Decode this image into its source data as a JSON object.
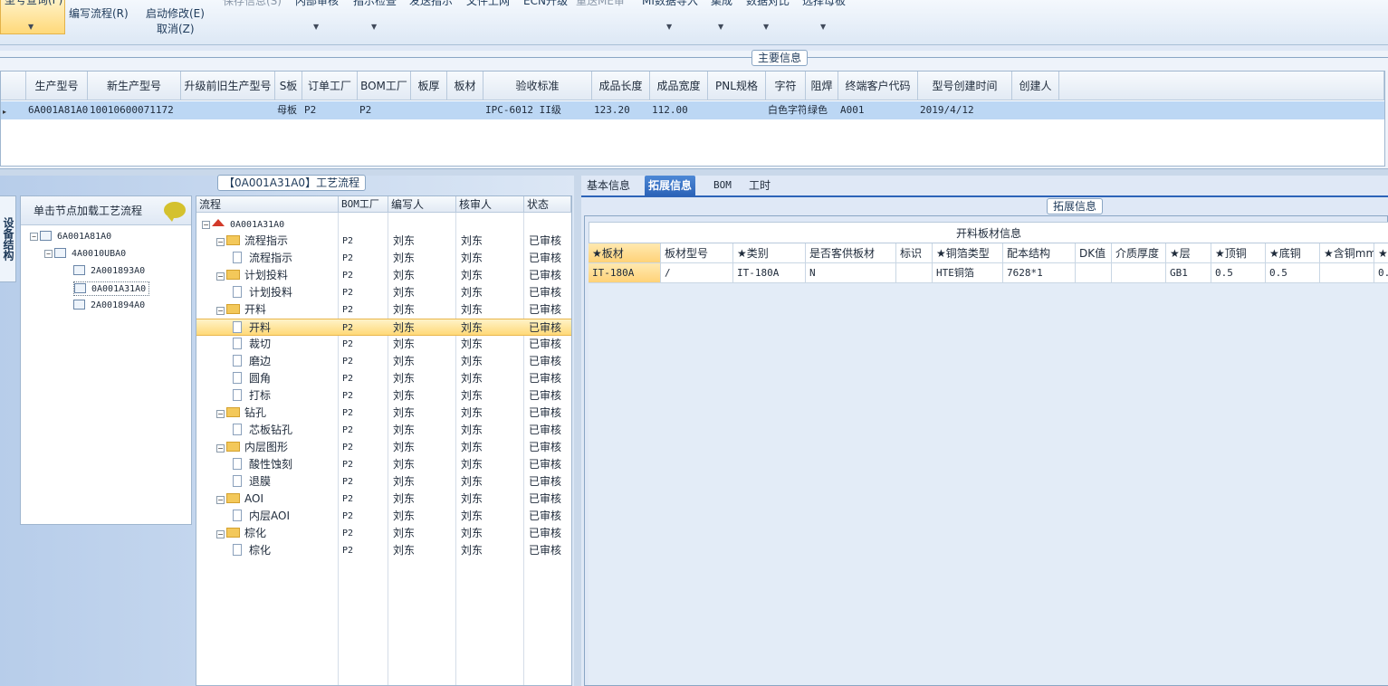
{
  "toolbar": {
    "query_label": "型号查询(F)",
    "write_label": "编写流程(R)",
    "start_edit_label": "启动修改(E)",
    "cancel_label": "取消(Z)",
    "save_label": "保存信息(S)",
    "inner_review_label": "内部审核",
    "instruction_check_label": "指示检查",
    "send_instruction_label": "发送指示",
    "doc_upload_label": "文件上网",
    "ecn_label": "ECN升级",
    "rework_label": "重送ME审",
    "mi_import_label": "MI数据导入",
    "set_label": "集成",
    "data_compare_label": "数据对比",
    "select_template_label": "选择母板"
  },
  "main_info": {
    "title": "主要信息",
    "columns": [
      "生产型号",
      "新生产型号",
      "升级前旧生产型号",
      "S板",
      "订单工厂",
      "BOM工厂",
      "板厚",
      "板材",
      "验收标准",
      "成品长度",
      "成品宽度",
      "PNL规格",
      "字符",
      "阻焊",
      "终端客户代码",
      "型号创建时间",
      "创建人"
    ],
    "row": [
      "6A001A81A0",
      "10010600071172",
      "",
      "母板",
      "P2",
      "P2",
      "",
      "",
      "IPC-6012 II级",
      "123.20",
      "112.00",
      "",
      "白色字符",
      "绿色",
      "A001",
      "2019/4/12",
      ""
    ]
  },
  "left": {
    "vertical_tab": "设备结构",
    "structure_header": "单击节点加载工艺流程",
    "structure_nodes": [
      "6A001A81A0",
      "4A0010UBA0",
      "2A001893A0",
      "0A001A31A0",
      "2A001894A0"
    ],
    "process_title": "【0A001A31A0】工艺流程",
    "process_columns": [
      "流程",
      "BOM工厂",
      "编写人",
      "核审人",
      "状态"
    ],
    "process_root": "0A001A31A0",
    "process_rows": [
      {
        "name": "流程指示",
        "type": "folder",
        "bom": "P2",
        "writer": "刘东",
        "reviewer": "刘东",
        "status": "已审核"
      },
      {
        "name": "流程指示",
        "type": "file",
        "bom": "P2",
        "writer": "刘东",
        "reviewer": "刘东",
        "status": "已审核"
      },
      {
        "name": "计划投料",
        "type": "folder",
        "bom": "P2",
        "writer": "刘东",
        "reviewer": "刘东",
        "status": "已审核"
      },
      {
        "name": "计划投料",
        "type": "file",
        "bom": "P2",
        "writer": "刘东",
        "reviewer": "刘东",
        "status": "已审核"
      },
      {
        "name": "开料",
        "type": "folder",
        "bom": "P2",
        "writer": "刘东",
        "reviewer": "刘东",
        "status": "已审核"
      },
      {
        "name": "开料",
        "type": "file",
        "bom": "P2",
        "writer": "刘东",
        "reviewer": "刘东",
        "status": "已审核",
        "selected": true
      },
      {
        "name": "裁切",
        "type": "file",
        "bom": "P2",
        "writer": "刘东",
        "reviewer": "刘东",
        "status": "已审核"
      },
      {
        "name": "磨边",
        "type": "file",
        "bom": "P2",
        "writer": "刘东",
        "reviewer": "刘东",
        "status": "已审核"
      },
      {
        "name": "圆角",
        "type": "file",
        "bom": "P2",
        "writer": "刘东",
        "reviewer": "刘东",
        "status": "已审核"
      },
      {
        "name": "打标",
        "type": "file",
        "bom": "P2",
        "writer": "刘东",
        "reviewer": "刘东",
        "status": "已审核"
      },
      {
        "name": "钻孔",
        "type": "folder",
        "bom": "P2",
        "writer": "刘东",
        "reviewer": "刘东",
        "status": "已审核"
      },
      {
        "name": "芯板钻孔",
        "type": "file",
        "bom": "P2",
        "writer": "刘东",
        "reviewer": "刘东",
        "status": "已审核"
      },
      {
        "name": "内层图形",
        "type": "folder",
        "bom": "P2",
        "writer": "刘东",
        "reviewer": "刘东",
        "status": "已审核"
      },
      {
        "name": "酸性蚀刻",
        "type": "file",
        "bom": "P2",
        "writer": "刘东",
        "reviewer": "刘东",
        "status": "已审核"
      },
      {
        "name": "退膜",
        "type": "file",
        "bom": "P2",
        "writer": "刘东",
        "reviewer": "刘东",
        "status": "已审核"
      },
      {
        "name": "AOI",
        "type": "folder",
        "bom": "P2",
        "writer": "刘东",
        "reviewer": "刘东",
        "status": "已审核"
      },
      {
        "name": "内层AOI",
        "type": "file",
        "bom": "P2",
        "writer": "刘东",
        "reviewer": "刘东",
        "status": "已审核"
      },
      {
        "name": "棕化",
        "type": "folder",
        "bom": "P2",
        "writer": "刘东",
        "reviewer": "刘东",
        "status": "已审核"
      },
      {
        "name": "棕化",
        "type": "file",
        "bom": "P2",
        "writer": "刘东",
        "reviewer": "刘东",
        "status": "已审核"
      }
    ]
  },
  "right": {
    "tabs": [
      "基本信息",
      "拓展信息",
      "BOM",
      "工时"
    ],
    "active_tab": "拓展信息",
    "group_title": "拓展信息",
    "sheet_title": "开料板材信息",
    "columns": [
      "★板材",
      "板材型号",
      "★类别",
      "是否客供板材",
      "标识",
      "★铜箔类型",
      "配本结构",
      "DK值",
      "介质厚度",
      "★层",
      "★顶铜",
      "★底铜",
      "★含铜mm",
      "★"
    ],
    "row": [
      "IT-180A",
      "/",
      "IT-180A",
      "N",
      "",
      "HTE铜箔",
      "7628*1",
      "",
      "",
      "GB1",
      "0.5",
      "0.5",
      "",
      "0."
    ]
  }
}
